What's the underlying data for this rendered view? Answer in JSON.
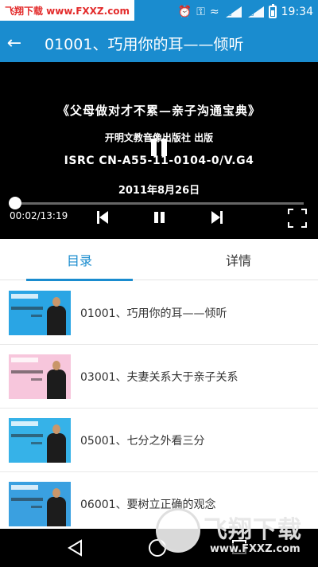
{
  "status_bar": {
    "watermark": "飞翔下载 www.FXXZ.com",
    "time": "19:34",
    "signal_label_1": "2G",
    "signal_label_2": "2G",
    "background": "#1a8ccf"
  },
  "app_bar": {
    "title": "01001、巧用你的耳——倾听"
  },
  "player": {
    "line1": "《父母做对才不累—亲子沟通宝典》",
    "line2": "开明文教音像出版社  出版",
    "line3": "ISRC CN-A55-11-0104-0/V.G4",
    "line4": "2011年8月26日",
    "time": "00:02/13:19",
    "progress_fraction": 0.0025
  },
  "tabs": [
    {
      "label": "目录",
      "active": true
    },
    {
      "label": "详情",
      "active": false
    }
  ],
  "list": [
    {
      "label": "01001、巧用你的耳——倾听",
      "thumb_bg": "#2aa5e4"
    },
    {
      "label": "03001、夫妻关系大于亲子关系",
      "thumb_bg": "#f7c6dc"
    },
    {
      "label": "05001、七分之外看三分",
      "thumb_bg": "#36b2e8"
    },
    {
      "label": "06001、要树立正确的观念",
      "thumb_bg": "#3aa0e0"
    }
  ],
  "watermark": {
    "brand": "飞翔下载",
    "url": "www.FXXZ.com"
  },
  "colors": {
    "accent": "#1a8ccf"
  }
}
